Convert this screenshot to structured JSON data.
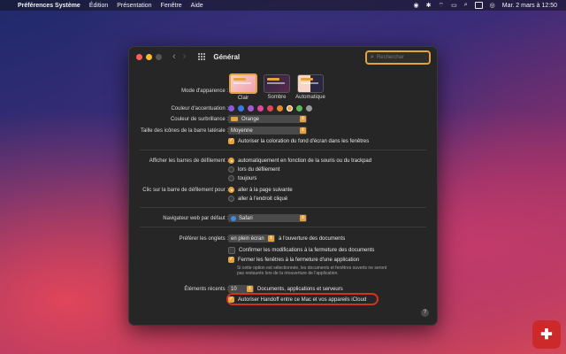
{
  "menubar": {
    "app": "Préférences Système",
    "items": [
      "Édition",
      "Présentation",
      "Fenêtre",
      "Aide"
    ],
    "datetime": "Mar. 2 mars à  12:50"
  },
  "window": {
    "title": "Général",
    "search_placeholder": "Rechercher"
  },
  "appearance": {
    "label": "Mode d'apparence :",
    "options": [
      "Clair",
      "Sombre",
      "Automatique"
    ],
    "selected": "Clair"
  },
  "accent": {
    "label": "Couleur d'accentuation :",
    "colors": [
      "#8a5cd6",
      "#3b7be0",
      "#a55ad1",
      "#e0489a",
      "#e0485a",
      "#e68a2e",
      "#e6a23c",
      "#5cb85c",
      "#9a9a9a"
    ],
    "selected_index": 6
  },
  "highlight_color": {
    "label": "Couleur de surbrillance :",
    "value": "Orange",
    "swatch": "#e6a23c"
  },
  "sidebar_icons": {
    "label": "Taille des icônes de la barre latérale :",
    "value": "Moyenne"
  },
  "wallpaper_tint": {
    "label": "Autoriser la coloration du fond d'écran dans les fenêtres",
    "checked": true
  },
  "scrollbars": {
    "label": "Afficher les barres de défilement :",
    "options": [
      "automatiquement en fonction de la souris ou du trackpad",
      "lors du défilement",
      "toujours"
    ],
    "selected_index": 0
  },
  "scroll_click": {
    "label": "Clic sur la barre de défilement pour :",
    "options": [
      "aller à la page suivante",
      "aller à l'endroit cliqué"
    ],
    "selected_index": 0
  },
  "browser": {
    "label": "Navigateur web par défaut :",
    "value": "Safari"
  },
  "tabs": {
    "label": "Préférer les onglets :",
    "value": "en plein écran",
    "suffix": "à l'ouverture des documents"
  },
  "checks": {
    "confirm_changes": "Confirmer les modifications à la fermeture des documents",
    "close_windows": "Fermer les fenêtres à la fermeture d'une application",
    "close_windows_note": "Si cette option est sélectionnée, les documents et fenêtres ouverts ne seront pas restaurés lors de la réouverture de l'application."
  },
  "recent": {
    "label": "Éléments récents :",
    "value": "10",
    "suffix": "Documents, applications et serveurs"
  },
  "handoff": {
    "label": "Autoriser Handoff entre ce Mac et vos appareils iCloud",
    "checked": true
  },
  "help": "?"
}
